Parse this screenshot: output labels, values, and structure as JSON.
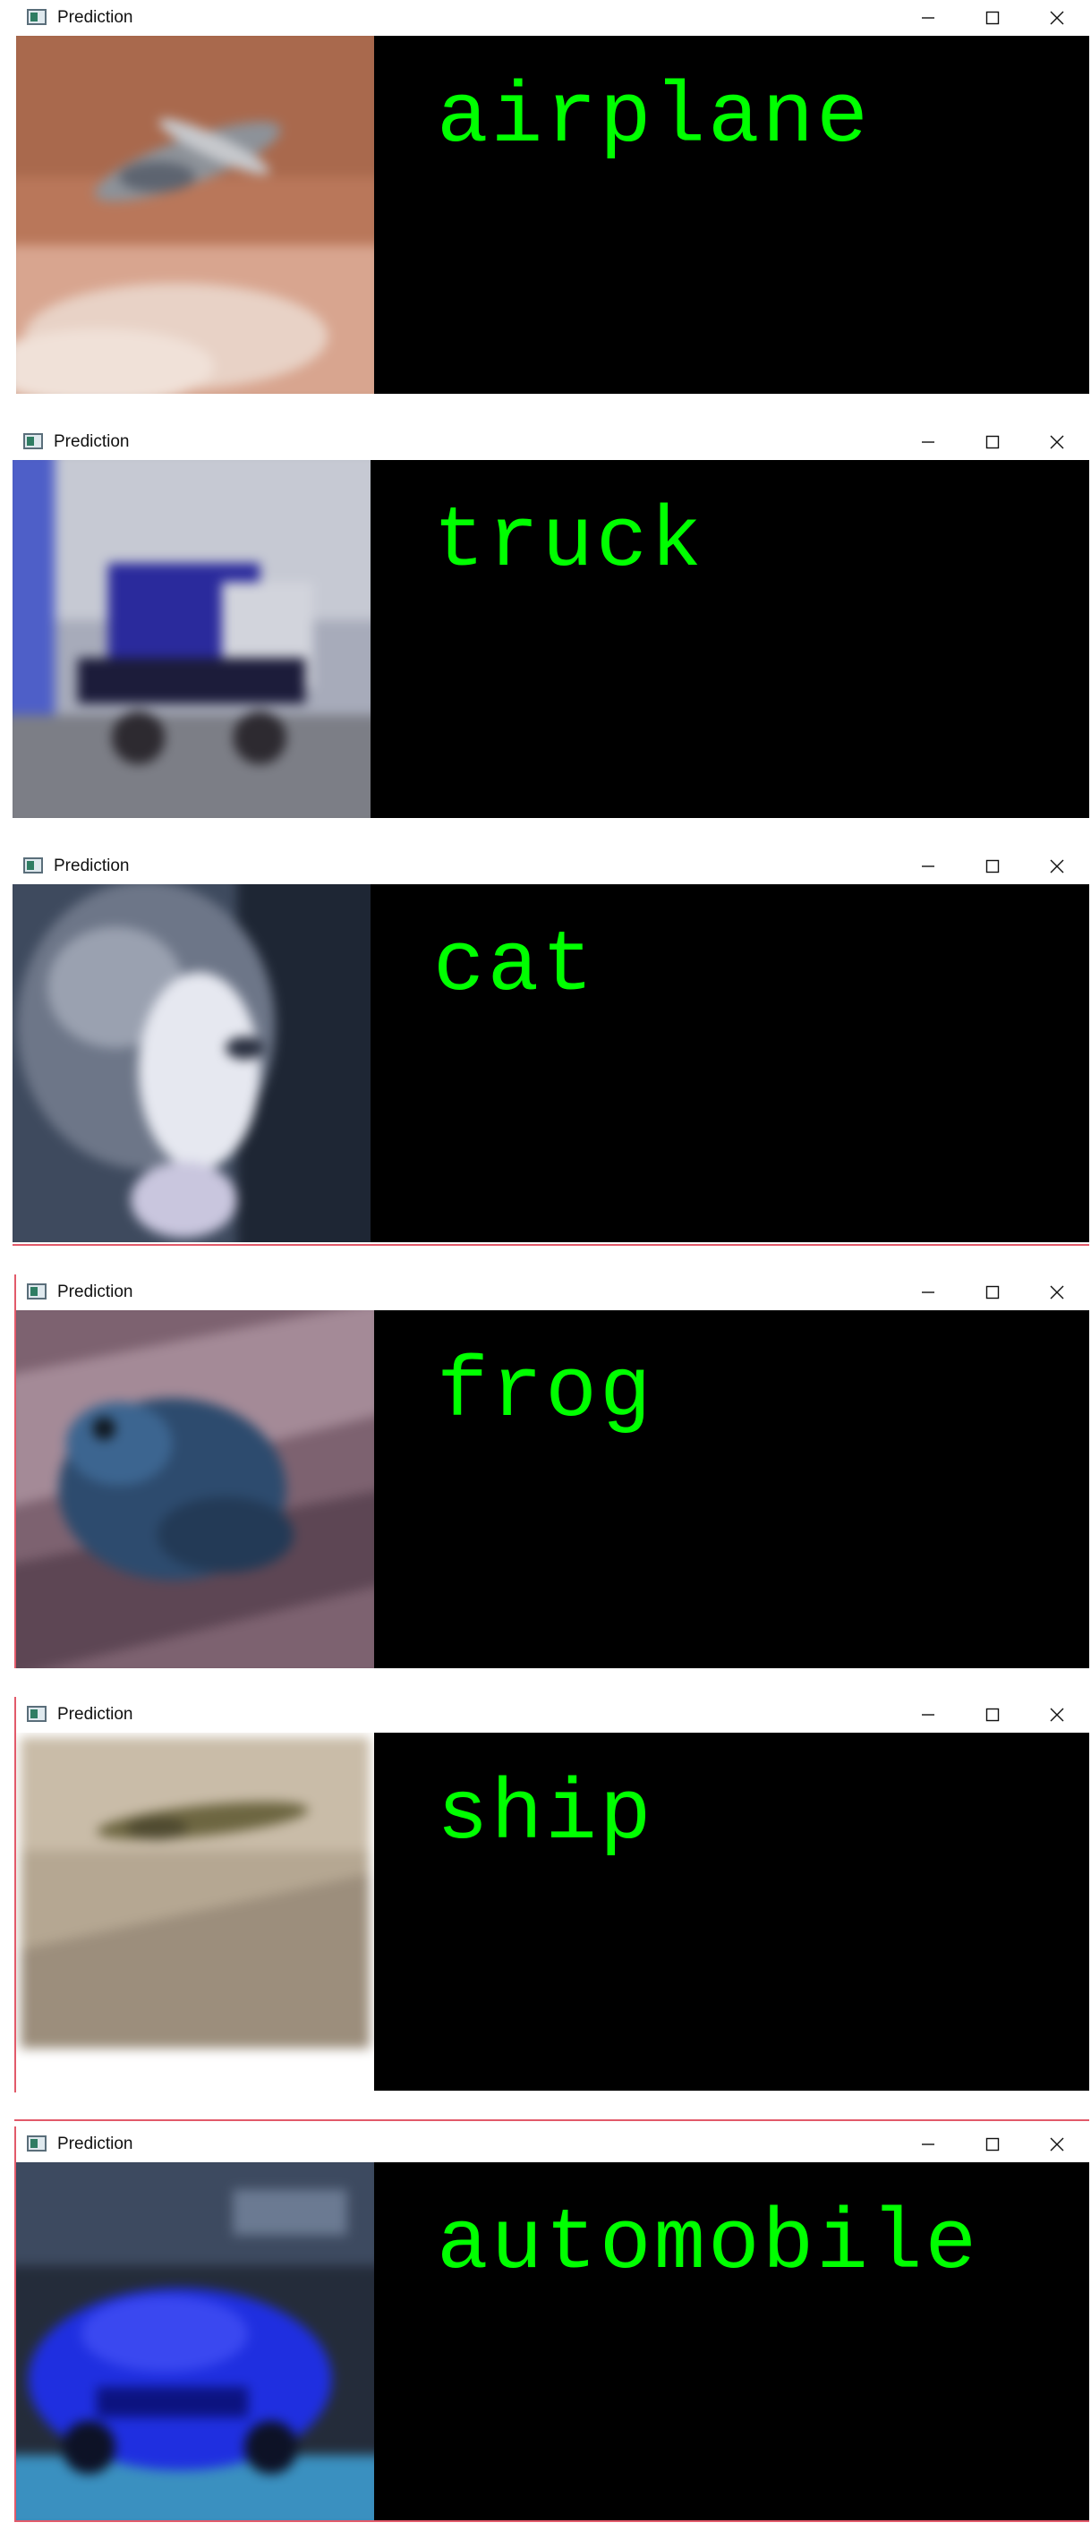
{
  "windows": [
    {
      "title": "Prediction",
      "prediction": "airplane",
      "image": "airplane-image",
      "colors": {
        "sky": "#c88a6a",
        "subject": "#8a8f98"
      }
    },
    {
      "title": "Prediction",
      "prediction": "truck",
      "image": "truck-image",
      "colors": {
        "sky": "#b9bcc8",
        "subject": "#2a2aa0"
      }
    },
    {
      "title": "Prediction",
      "prediction": "cat",
      "image": "cat-image",
      "colors": {
        "sky": "#3a4658",
        "subject": "#d8dbe6"
      }
    },
    {
      "title": "Prediction",
      "prediction": "frog",
      "image": "frog-image",
      "colors": {
        "sky": "#8a6f7a",
        "subject": "#2f4f72"
      }
    },
    {
      "title": "Prediction",
      "prediction": "ship",
      "image": "ship-image",
      "colors": {
        "sky": "#b8a892",
        "subject": "#6f6a45"
      }
    },
    {
      "title": "Prediction",
      "prediction": "automobile",
      "image": "automobile-image",
      "colors": {
        "sky": "#2a3342",
        "subject": "#1f2fe0"
      }
    }
  ],
  "icons": {
    "app": "app-icon",
    "minimize": "minimize-icon",
    "maximize": "maximize-icon",
    "close": "close-icon"
  },
  "colors": {
    "label_text": "#00ff00",
    "content_bg": "#000000",
    "titlebar_bg": "#ffffff",
    "focus_border": "#e25a6a"
  }
}
